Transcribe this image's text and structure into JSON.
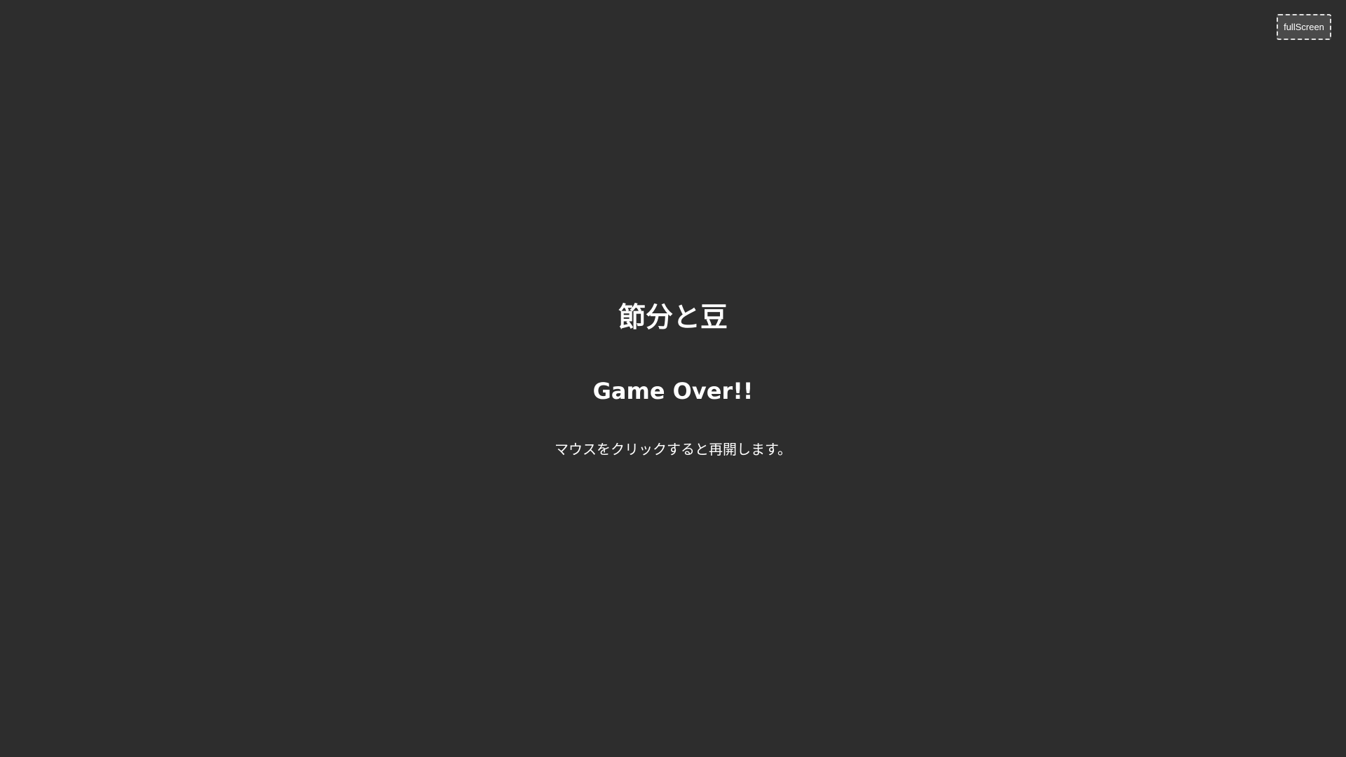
{
  "toolbar": {
    "fullscreen_label": "fullScreen"
  },
  "game": {
    "title": "節分と豆",
    "status": "Game Over!!",
    "instruction": "マウスをクリックすると再開します。"
  },
  "colors": {
    "background": "#2d2d2d",
    "text": "#ffffff",
    "button_background": "#4a4a4a",
    "button_border": "#e0e0e0"
  }
}
